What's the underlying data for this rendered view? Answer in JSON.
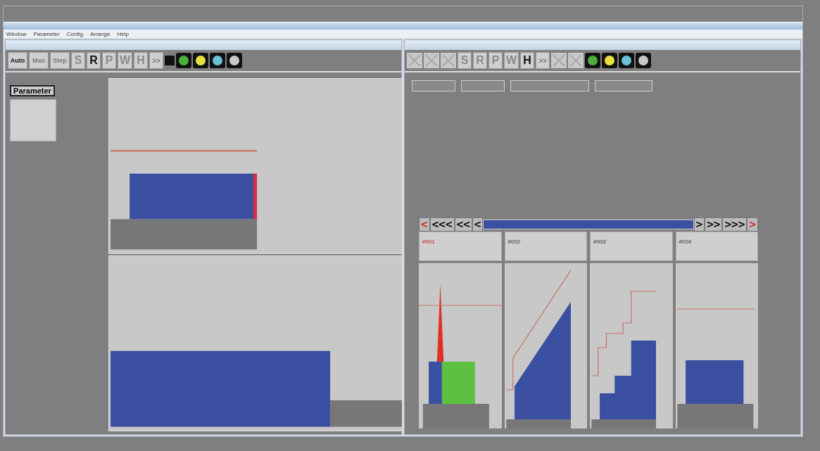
{
  "menu": [
    "Window",
    "Parameter",
    "Config",
    "Arrange",
    "Help"
  ],
  "left_window": {
    "modes": [
      {
        "label": "Auto",
        "disabled": false
      },
      {
        "label": "Man",
        "disabled": true
      },
      {
        "label": "Step",
        "disabled": true
      }
    ],
    "letters": [
      {
        "label": "S",
        "active": false
      },
      {
        "label": "R",
        "active": true
      },
      {
        "label": "P",
        "active": false
      },
      {
        "label": "W",
        "active": false
      },
      {
        "label": "H",
        "active": false
      }
    ],
    "forward": {
      "label": ">>",
      "disabled": true
    },
    "lights": [
      {
        "color": "#4caf3c"
      },
      {
        "color": "#e8e040"
      },
      {
        "color": "#6cc0d8"
      },
      {
        "color": "#c8c8c8"
      }
    ],
    "parameter_button": "Parameter"
  },
  "right_window": {
    "letters": [
      {
        "label": "S",
        "active": false
      },
      {
        "label": "R",
        "active": false
      },
      {
        "label": "P",
        "active": false
      },
      {
        "label": "W",
        "active": false
      },
      {
        "label": "H",
        "active": true
      }
    ],
    "forward": {
      "label": ">>",
      "disabled": true
    },
    "lights": [
      {
        "color": "#4caf3c"
      },
      {
        "color": "#e8e040"
      },
      {
        "color": "#6cc0d8"
      },
      {
        "color": "#c8c8c8"
      }
    ],
    "nav_back": [
      "<",
      "<<<",
      "<<",
      "<"
    ],
    "nav_forward": [
      ">",
      ">>",
      ">>>",
      ">"
    ],
    "cards": [
      {
        "title": "#001",
        "selected": true
      },
      {
        "title": "#002",
        "selected": false
      },
      {
        "title": "#003",
        "selected": false
      },
      {
        "title": "#004",
        "selected": false
      }
    ]
  }
}
